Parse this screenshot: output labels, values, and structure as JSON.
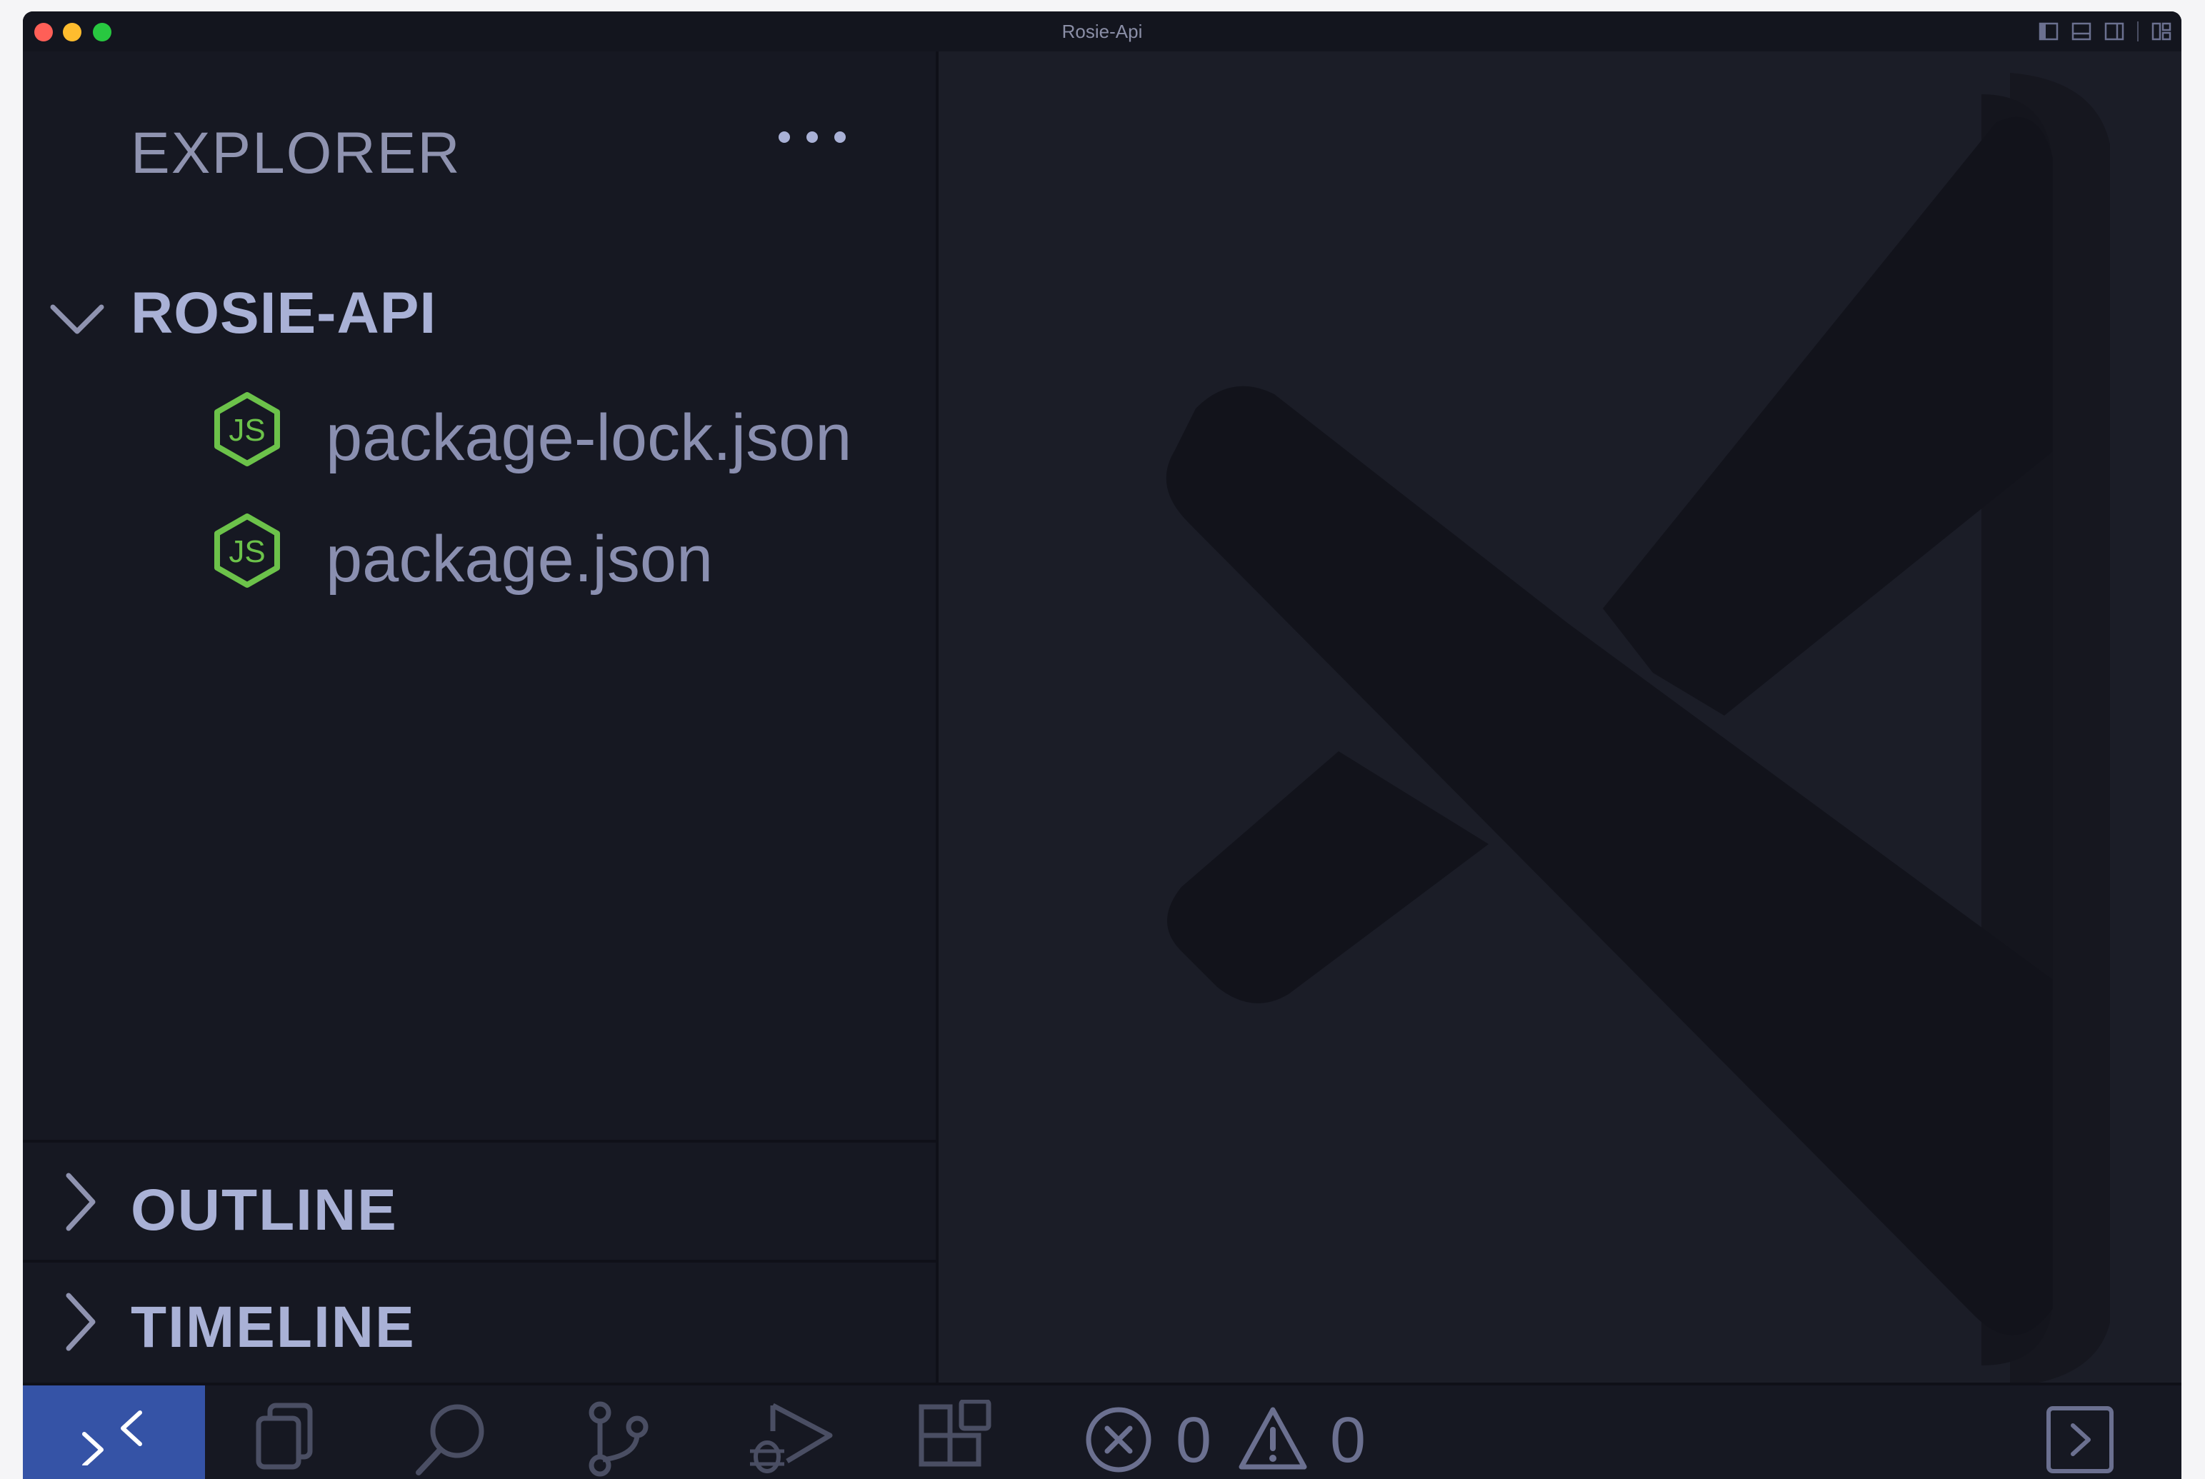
{
  "window": {
    "title": "Rosie-Api"
  },
  "sidebar": {
    "header": "EXPLORER",
    "folder": {
      "name": "ROSIE-API",
      "expanded": true
    },
    "files": [
      {
        "name": "package-lock.json",
        "icon": "nodejs-icon"
      },
      {
        "name": "package.json",
        "icon": "nodejs-icon"
      }
    ],
    "sections": [
      {
        "label": "OUTLINE",
        "expanded": false
      },
      {
        "label": "TIMELINE",
        "expanded": false
      }
    ]
  },
  "statusbar": {
    "errors": "0",
    "warnings": "0"
  },
  "colors": {
    "accent": "#3553a6",
    "nodejs": "#6cc24a",
    "text": "#a9b1d6"
  }
}
